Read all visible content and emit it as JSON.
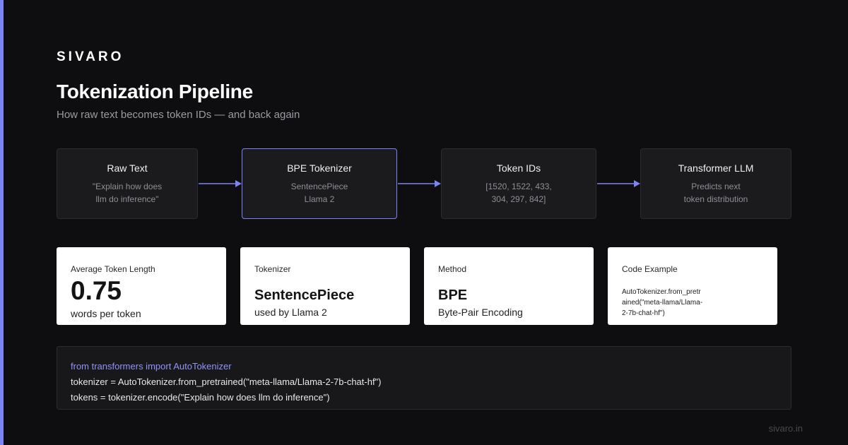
{
  "brand": "SIVARO",
  "title": "Tokenization Pipeline",
  "subtitle": "How raw text becomes token IDs — and back again",
  "pipeline": {
    "nodes": [
      {
        "title": "Raw Text",
        "lines": [
          "\"Explain how does",
          "llm do inference\""
        ]
      },
      {
        "title": "BPE Tokenizer",
        "lines": [
          "SentencePiece",
          "Llama 2"
        ]
      },
      {
        "title": "Token IDs",
        "lines": [
          "[1520, 1522, 433,",
          "304, 297, 842]"
        ]
      },
      {
        "title": "Transformer LLM",
        "lines": [
          "Predicts next",
          "token distribution"
        ]
      }
    ],
    "highlight_color": "#7c83f5"
  },
  "cards": [
    {
      "label": "Average Token Length",
      "value": "0.75",
      "footer": "words per token"
    },
    {
      "label": "Tokenizer",
      "value": "SentencePiece",
      "footer": "used by Llama 2"
    },
    {
      "label": "Method",
      "value": "BPE",
      "footer": "Byte-Pair Encoding"
    },
    {
      "label": "Code Example",
      "code": "AutoTokenizer.from_pretrained(\"meta-llama/Llama-2-7b-chat-hf\")"
    }
  ],
  "code": {
    "lines": [
      "from transformers import AutoTokenizer",
      "tokenizer = AutoTokenizer.from_pretrained(\"meta-llama/Llama-2-7b-chat-hf\")",
      "tokens = tokenizer.encode(\"Explain how does llm do inference\")"
    ]
  },
  "footer": "sivaro.in"
}
